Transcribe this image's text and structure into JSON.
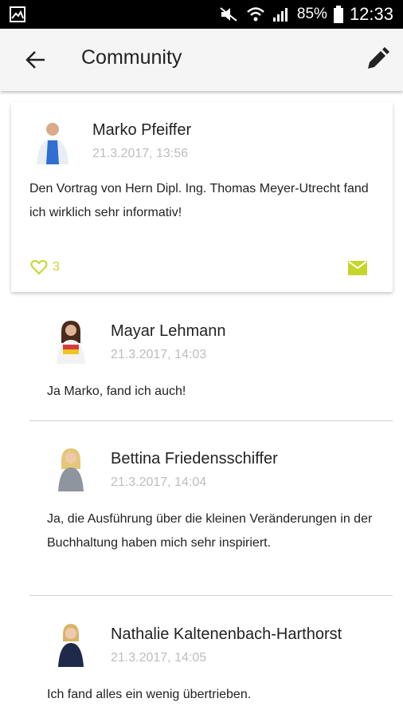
{
  "status_bar": {
    "battery": "85%",
    "time": "12:33"
  },
  "app_bar": {
    "title": "Community"
  },
  "post": {
    "author": "Marko Pfeiffer",
    "date": "21.3.2017, 13:56",
    "text": "Den Vortrag von Hern Dipl. Ing. Thomas Meyer-Utrecht fand ich wirklich sehr informativ!",
    "likes": "3"
  },
  "replies": [
    {
      "author": "Mayar Lehmann",
      "date": "21.3.2017, 14:03",
      "text": "Ja Marko, fand ich auch!"
    },
    {
      "author": "Bettina Friedensschiffer",
      "date": "21.3.2017, 14:04",
      "text": "Ja, die Ausführung über die kleinen Veränderungen in der Buchhaltung haben mich sehr inspiriert."
    },
    {
      "author": "Nathalie Kaltenenbach-Harthorst",
      "date": "21.3.2017, 14:05",
      "text": "Ich fand alles ein wenig übertrieben."
    }
  ],
  "colors": {
    "accent": "#c6d52a",
    "date": "#bdbdbd",
    "appbar": "#f5f5f5"
  }
}
